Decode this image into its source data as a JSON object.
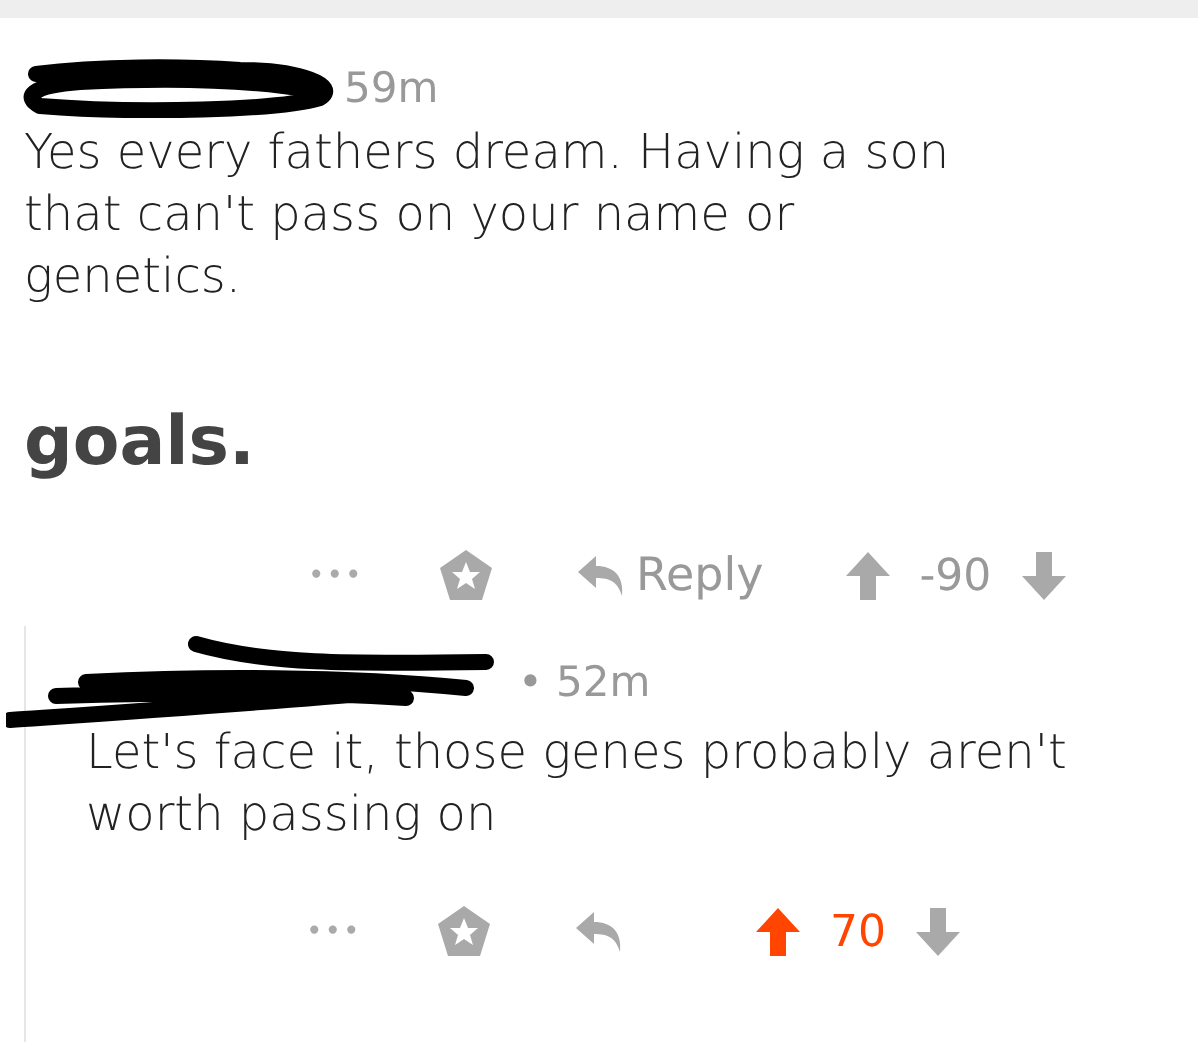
{
  "comments": [
    {
      "time": "59m",
      "paragraphs": [
        {
          "text": "Yes every fathers dream. Having a son that can't pass on your name or genetics.",
          "bold": false
        },
        {
          "text": "goals.",
          "bold": true
        }
      ],
      "more": "•••",
      "reply_label": "Reply",
      "score": "-90",
      "upvoted": false,
      "children": [
        {
          "separator": "•",
          "time": "52m",
          "paragraphs": [
            {
              "text": "Let's face it, those genes probably aren't worth passing on",
              "bold": false
            }
          ],
          "more": "•••",
          "score": "70",
          "upvoted": true
        }
      ]
    }
  ]
}
